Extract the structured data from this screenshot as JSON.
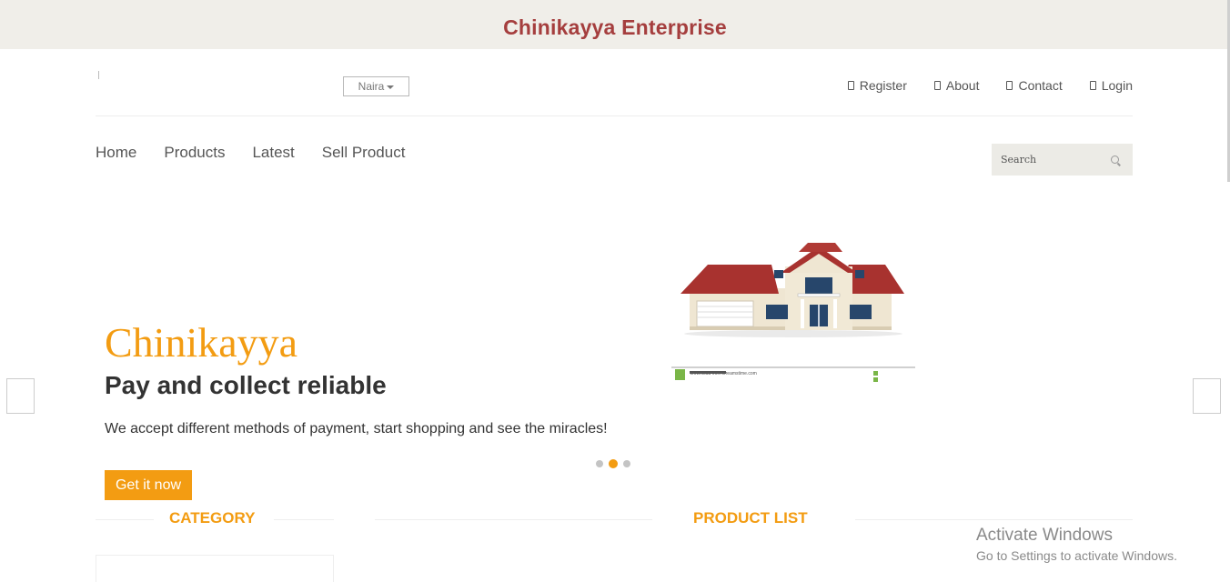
{
  "topbar": {
    "title": "Chinikayya Enterprise"
  },
  "header": {
    "currency": {
      "selected": "Naira"
    },
    "links": [
      {
        "label": "Register",
        "icon": "user-icon"
      },
      {
        "label": "About",
        "icon": "info-icon"
      },
      {
        "label": "Contact",
        "icon": "phone-icon"
      },
      {
        "label": "Login",
        "icon": "lock-icon"
      }
    ]
  },
  "nav": {
    "items": [
      "Home",
      "Products",
      "Latest",
      "Sell Product"
    ]
  },
  "search": {
    "placeholder": "Search"
  },
  "hero": {
    "brand": "Chinikayya",
    "heading": "Pay and collect reliable",
    "text": "We accept different methods of payment, start shopping and see the miracles!",
    "button": "Get it now",
    "image_caption": "Download from Dreamstime.com",
    "active_slide": 2,
    "slide_count": 3
  },
  "sections": {
    "category": "CATEGORY",
    "product_list": "PRODUCT LIST"
  },
  "watermark": {
    "title": "Activate Windows",
    "subtitle": "Go to Settings to activate Windows."
  },
  "colors": {
    "accent": "#f39c12",
    "brand_title": "#a53e3e",
    "topbar_bg": "#f0eee9"
  }
}
